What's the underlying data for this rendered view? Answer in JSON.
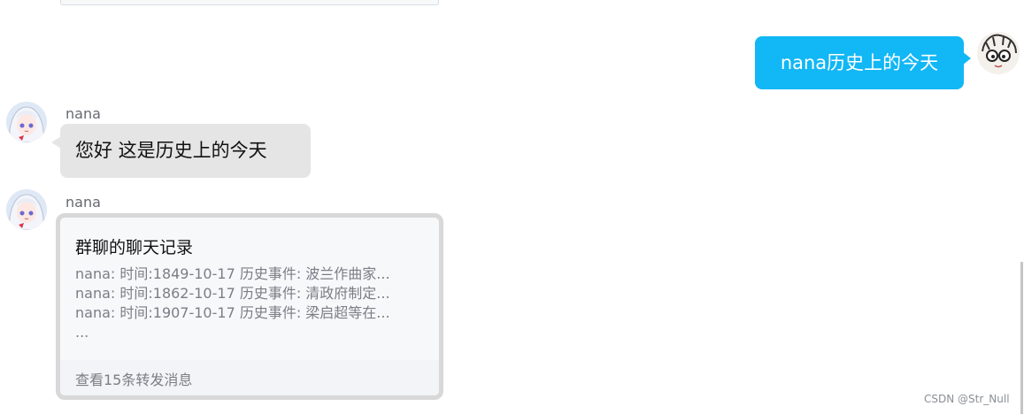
{
  "outgoing_message": {
    "text": "nana历史上的今天",
    "bubble_color": "#12b7f5"
  },
  "messages": [
    {
      "sender": "nana",
      "text": "您好 这是历史上的今天"
    },
    {
      "sender": "nana",
      "forward_card": {
        "title": "群聊的聊天记录",
        "lines": [
          "nana: 时间:1849-10-17 历史事件: 波兰作曲家...",
          "nana: 时间:1862-10-17 历史事件: 清政府制定...",
          "nana: 时间:1907-10-17 历史事件: 梁启超等在...",
          "..."
        ],
        "footer": "查看15条转发消息"
      }
    }
  ],
  "watermark": "CSDN @Str_Null",
  "icons": {
    "self_avatar": "cartoon-face-avatar",
    "bot_avatar": "anime-girl-avatar"
  },
  "colors": {
    "incoming_bubble": "#e5e5e5",
    "card_border": "#d8d8d8"
  }
}
